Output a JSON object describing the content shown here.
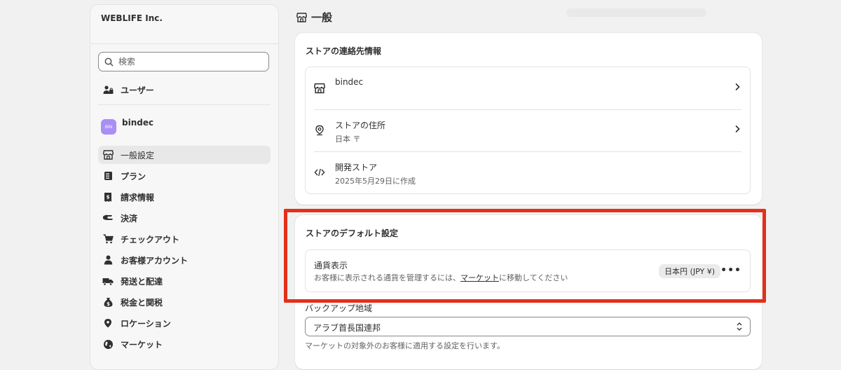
{
  "sidebar": {
    "org_name": "WEBLIFE Inc.",
    "search_placeholder": "検索",
    "users_label": "ユーザー",
    "store": {
      "avatar_text": "BIN",
      "name": "bindec"
    },
    "items": [
      {
        "label": "一般設定",
        "icon": "store-icon",
        "active": true
      },
      {
        "label": "プラン",
        "icon": "plan-icon"
      },
      {
        "label": "請求情報",
        "icon": "billing-icon"
      },
      {
        "label": "決済",
        "icon": "payment-icon"
      },
      {
        "label": "チェックアウト",
        "icon": "cart-icon"
      },
      {
        "label": "お客様アカウント",
        "icon": "person-icon"
      },
      {
        "label": "発送と配達",
        "icon": "truck-icon"
      },
      {
        "label": "税金と関税",
        "icon": "money-bag-icon"
      },
      {
        "label": "ロケーション",
        "icon": "location-icon"
      },
      {
        "label": "マーケット",
        "icon": "globe-icon"
      }
    ]
  },
  "main": {
    "page_title": "一般",
    "contact_card": {
      "title": "ストアの連絡先情報",
      "rows": [
        {
          "title": "bindec",
          "subtitle": ""
        },
        {
          "title": "ストアの住所",
          "subtitle": "日本 〒"
        },
        {
          "title": "開発ストア",
          "subtitle": "2025年5月29日に作成"
        }
      ]
    },
    "defaults_card": {
      "title": "ストアのデフォルト設定",
      "currency_title": "通貨表示",
      "currency_desc_before": "お客様に表示される通貨を管理するには、",
      "currency_desc_link": "マーケット",
      "currency_desc_after": "に移動してください",
      "currency_badge": "日本円 (JPY ¥)",
      "backup_region_label": "バックアップ地域",
      "backup_region_value": "アラブ首長国連邦",
      "backup_region_help": "マーケットの対象外のお客様に適用する設定を行います。"
    }
  },
  "colors": {
    "highlight": "#e3301b",
    "avatar": "#a98ef5"
  }
}
